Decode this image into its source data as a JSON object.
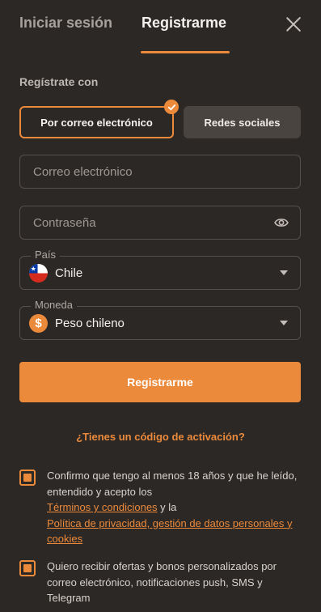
{
  "tabs": {
    "login": "Iniciar sesión",
    "register": "Registrarme"
  },
  "section_label": "Regístrate con",
  "methods": {
    "email": "Por correo electrónico",
    "social": "Redes sociales"
  },
  "fields": {
    "email_placeholder": "Correo electrónico",
    "password_placeholder": "Contraseña"
  },
  "country": {
    "legend": "País",
    "value": "Chile"
  },
  "currency": {
    "legend": "Moneda",
    "value": "Peso chileno",
    "symbol": "$"
  },
  "submit_label": "Registrarme",
  "activation_link": "¿Tienes un código de activación?",
  "consent_age": {
    "text": "Confirmo que tengo al menos 18 años y que he leído, entendido y acepto los",
    "terms_link": "Términos y condiciones",
    "connector": " y la",
    "privacy_link": "Política de privacidad, gestión de datos personales y cookies"
  },
  "consent_marketing": {
    "text": "Quiero recibir ofertas y bonos personalizados por correo electrónico, notificaciones push, SMS y Telegram"
  },
  "colors": {
    "accent": "#ec8a3b",
    "background": "#2c2826"
  },
  "icons": {
    "close": "close-icon",
    "check": "check-icon",
    "eye": "eye-icon",
    "flag": "chile-flag-icon",
    "coin": "coin-icon"
  }
}
